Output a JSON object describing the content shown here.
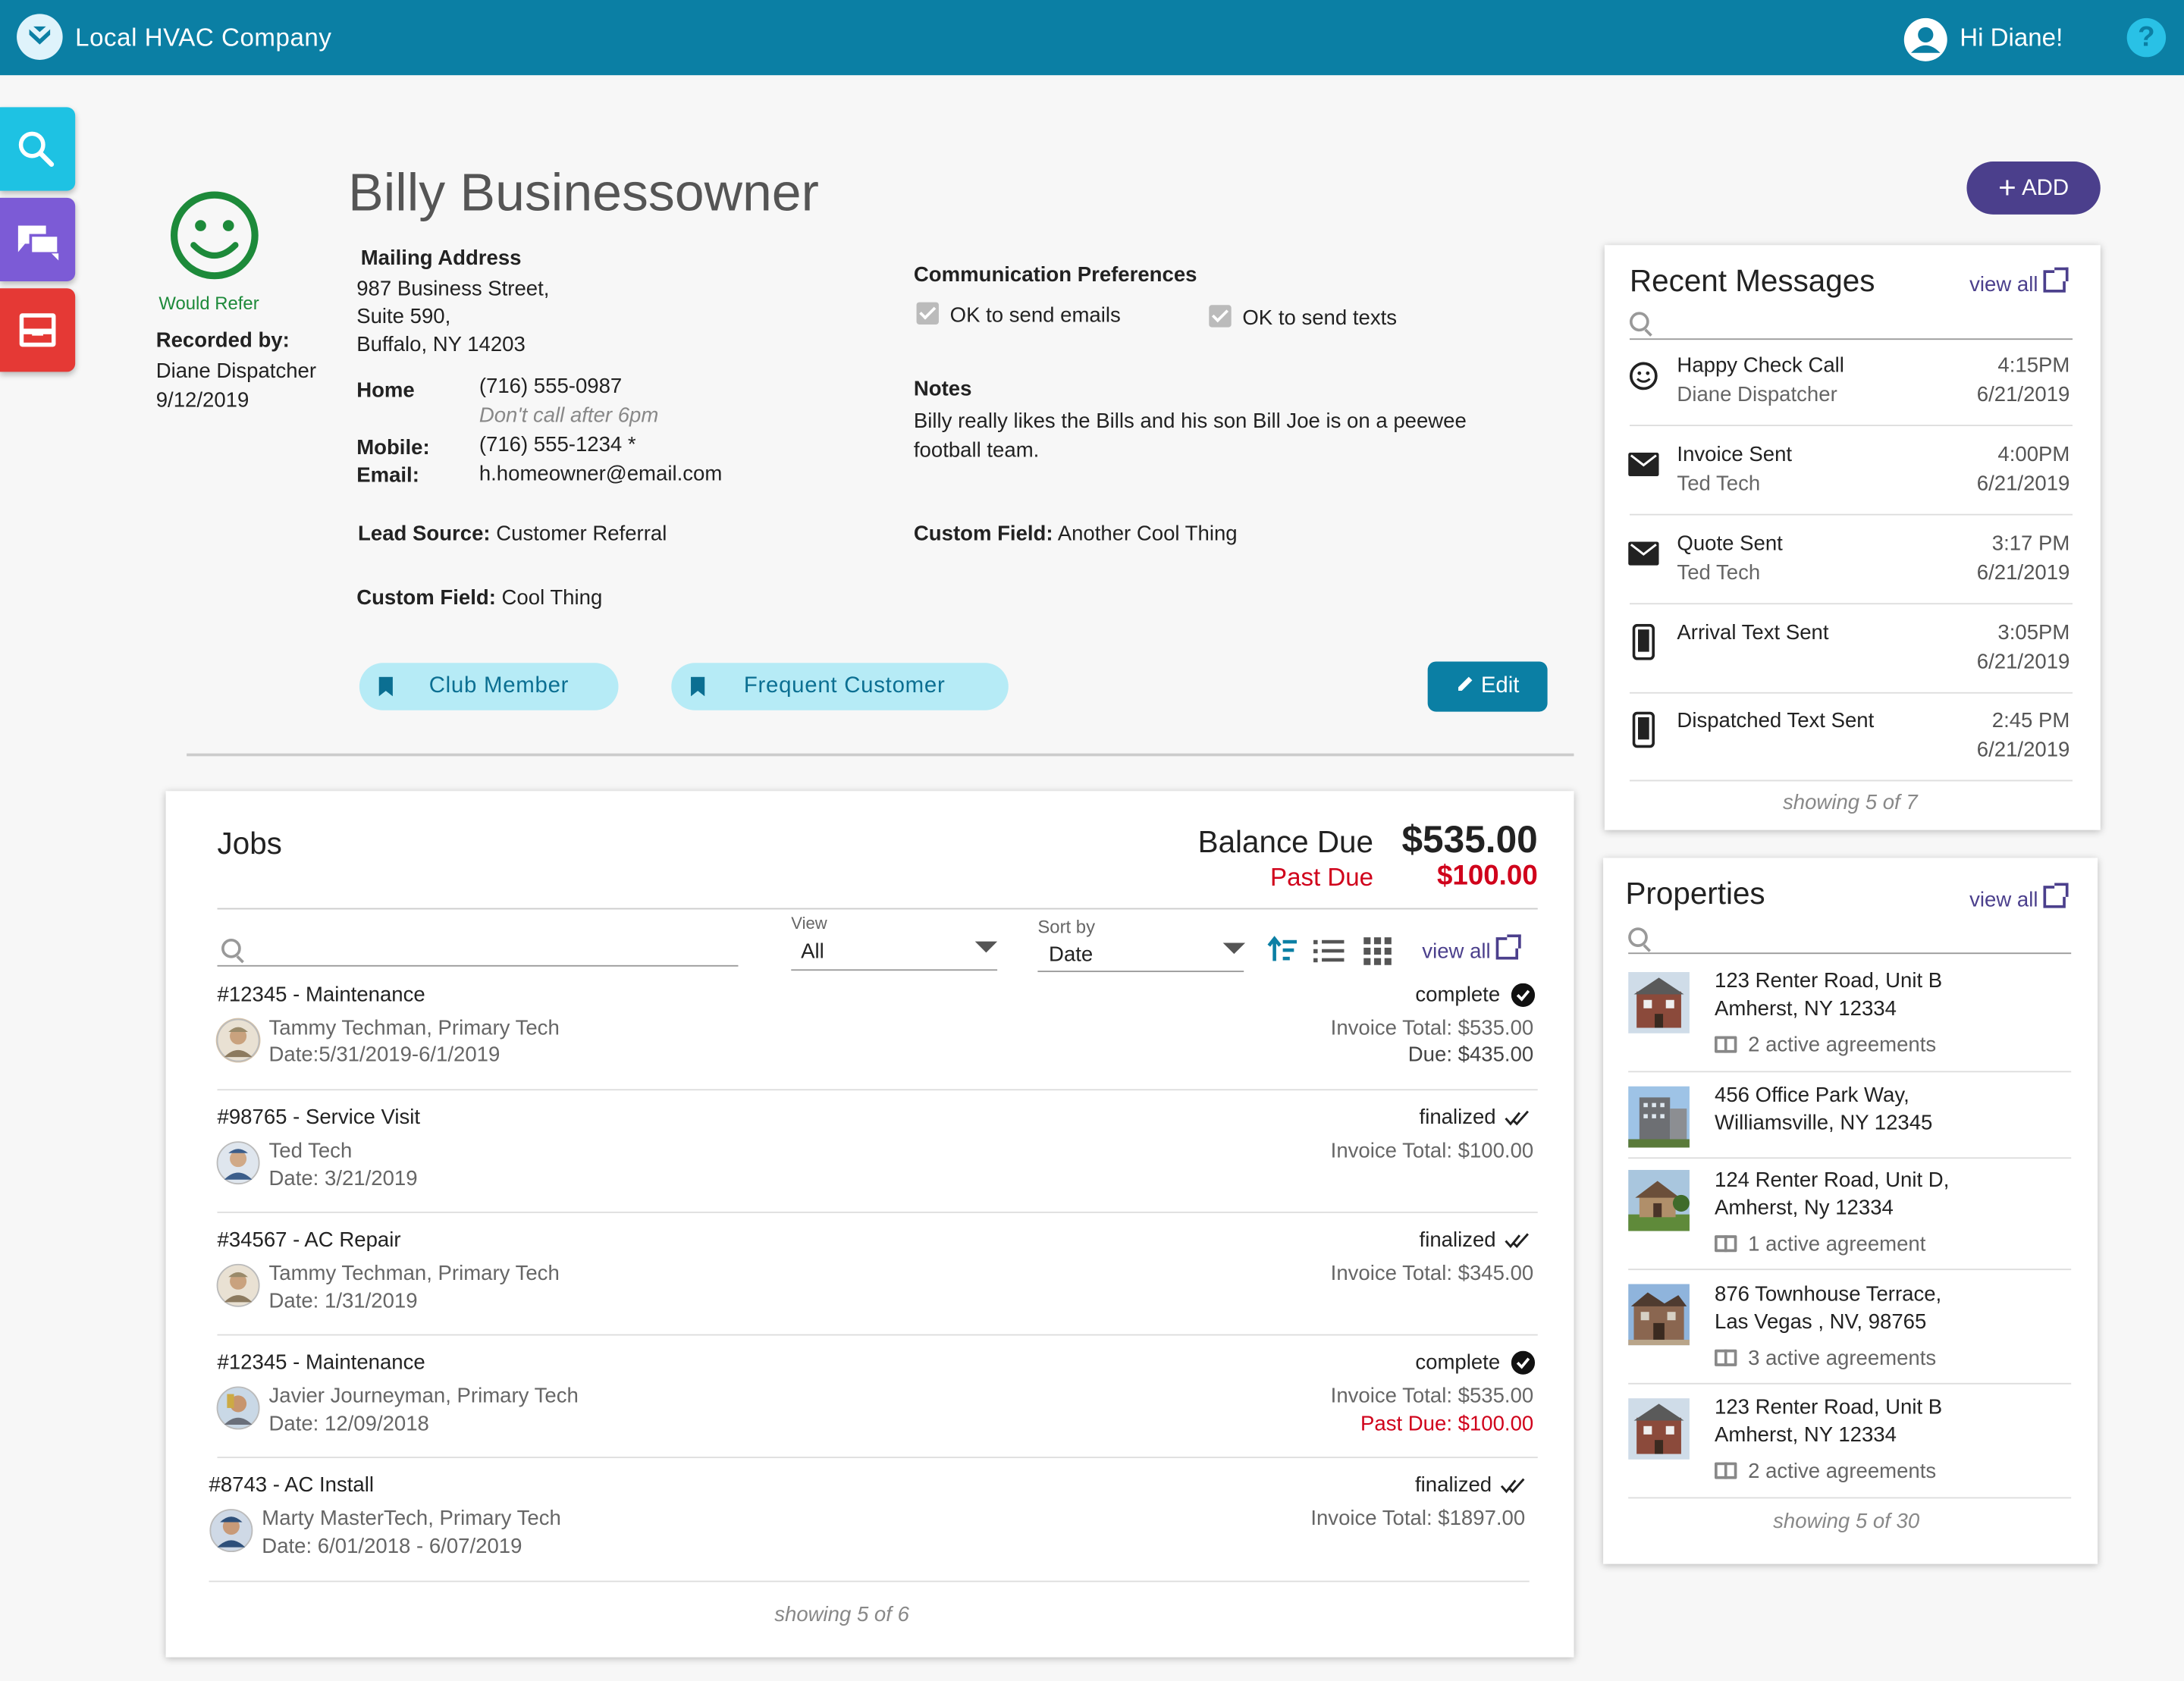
{
  "app": {
    "company": "Local HVAC Company",
    "greeting": "Hi Diane!",
    "help": "?"
  },
  "customer": {
    "name": "Billy Businessowner",
    "mood": "Would Refer",
    "recorded_by_label": "Recorded by:",
    "recorded_by": "Diane Dispatcher",
    "recorded_date": "9/12/2019",
    "mailing_label": "Mailing Address",
    "address": [
      "987 Business Street,",
      "Suite 590,",
      "Buffalo, NY 14203"
    ],
    "home_label": "Home",
    "home": "(716) 555-0987",
    "home_note": "Don't call after 6pm",
    "mobile_label": "Mobile:",
    "mobile": "(716) 555-1234 *",
    "email_label": "Email:",
    "email": "h.homeowner@email.com",
    "lead_source_label": "Lead Source:",
    "lead_source": "Customer Referral",
    "custom1_label": "Custom Field:",
    "custom1": "Cool Thing",
    "comm_label": "Communication Preferences",
    "comm_email": "OK to send emails",
    "comm_text": "OK to send texts",
    "notes_label": "Notes",
    "notes": "Billy really likes the Bills and his son Bill Joe is on a peewee football team.",
    "custom2_label": "Custom Field:",
    "custom2": "Another Cool Thing",
    "tags": [
      "Club Member",
      "Frequent Customer"
    ],
    "edit_label": "Edit",
    "add_label": "ADD"
  },
  "messages": {
    "title": "Recent Messages",
    "view_all": "view all",
    "items": [
      {
        "icon": "smiley-icon",
        "title": "Happy Check Call",
        "sub": "Diane Dispatcher",
        "time": "4:15PM",
        "date": "6/21/2019"
      },
      {
        "icon": "envelope-icon",
        "title": "Invoice Sent",
        "sub": "Ted Tech",
        "time": "4:00PM",
        "date": "6/21/2019"
      },
      {
        "icon": "envelope-icon",
        "title": "Quote Sent",
        "sub": "Ted Tech",
        "time": "3:17 PM",
        "date": "6/21/2019"
      },
      {
        "icon": "phone-icon",
        "title": "Arrival Text Sent",
        "sub": "",
        "time": "3:05PM",
        "date": "6/21/2019"
      },
      {
        "icon": "phone-icon",
        "title": "Dispatched Text Sent",
        "sub": "",
        "time": "2:45 PM",
        "date": "6/21/2019"
      }
    ],
    "showing": "showing 5 of 7"
  },
  "properties": {
    "title": "Properties",
    "view_all": "view all",
    "items": [
      {
        "line1": "123 Renter Road, Unit B",
        "line2": "Amherst, NY 12334",
        "agreements": "2 active agreements"
      },
      {
        "line1": "456 Office Park Way,",
        "line2": "Williamsville, NY 12345",
        "agreements": ""
      },
      {
        "line1": "124 Renter Road, Unit D,",
        "line2": "Amherst, Ny 12334",
        "agreements": "1 active agreement"
      },
      {
        "line1": "876 Townhouse Terrace,",
        "line2": "Las Vegas , NV, 98765",
        "agreements": "3 active agreements"
      },
      {
        "line1": "123 Renter Road, Unit B",
        "line2": "Amherst, NY 12334",
        "agreements": "2 active agreements"
      }
    ],
    "showing": "showing 5 of 30"
  },
  "jobs": {
    "title": "Jobs",
    "balance_label": "Balance Due",
    "balance": "$535.00",
    "past_due_label": "Past Due",
    "past_due": "$100.00",
    "view_label": "View",
    "view_value": "All",
    "sort_label": "Sort by",
    "sort_value": "Date",
    "view_all": "view all",
    "items": [
      {
        "title": "#12345 - Maintenance",
        "tech": "Tammy Techman, Primary Tech",
        "date": "Date:5/31/2019-6/1/2019",
        "status": "complete",
        "total": "Invoice Total: $535.00",
        "extra": "Due: $435.00",
        "extra_red": false
      },
      {
        "title": "#98765 - Service Visit",
        "tech": "Ted Tech",
        "date": "Date: 3/21/2019",
        "status": "finalized",
        "total": "Invoice Total: $100.00",
        "extra": "",
        "extra_red": false
      },
      {
        "title": "#34567 - AC Repair",
        "tech": "Tammy Techman, Primary Tech",
        "date": "Date: 1/31/2019",
        "status": "finalized",
        "total": "Invoice Total: $345.00",
        "extra": "",
        "extra_red": false
      },
      {
        "title": "#12345 - Maintenance",
        "tech": "Javier Journeyman, Primary Tech",
        "date": "Date: 12/09/2018",
        "status": "complete",
        "total": "Invoice Total: $535.00",
        "extra": "Past Due: $100.00",
        "extra_red": true
      },
      {
        "title": "#8743 - AC Install",
        "tech": "Marty MasterTech, Primary Tech",
        "date": "Date: 6/01/2018 - 6/07/2019",
        "status": "finalized",
        "total": "Invoice Total: $1897.00",
        "extra": "",
        "extra_red": false
      }
    ],
    "showing": "showing 5 of 6"
  },
  "colors": {
    "topbar": "#0b7fa4",
    "search": "#1ec2e3",
    "chat": "#7c5bd6",
    "inbox": "#e53935",
    "accent_purple": "#4b3f8c",
    "green": "#1d8a3a",
    "red": "#d0021b",
    "teal": "#0b6f92"
  }
}
